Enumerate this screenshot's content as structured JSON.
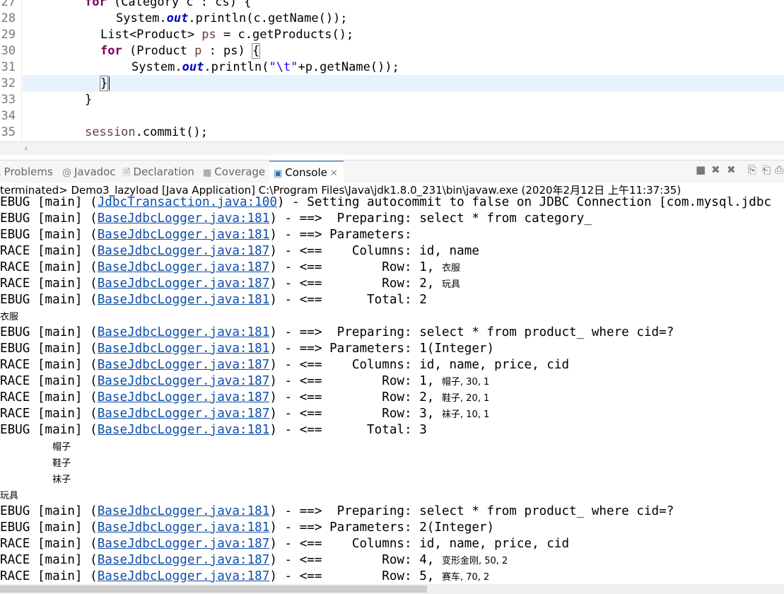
{
  "editor": {
    "line_numbers": [
      "27",
      "28",
      "29",
      "30",
      "31",
      "32",
      "33",
      "34",
      "35"
    ],
    "lines": {
      "l27": {
        "kw": "for",
        "text": " (Category c : cs) {"
      },
      "l28": {
        "a": "System.",
        "fld": "out",
        "b": ".println(c.getName());"
      },
      "l29": {
        "a": "List<Product> ",
        "var": "ps",
        "b": " = c.getProducts();"
      },
      "l30": {
        "kw": "for",
        "a": " (Product ",
        "var": "p",
        "b": " : ps) ",
        "br": "{"
      },
      "l31": {
        "a": "System.",
        "fld": "out",
        "b": ".println(",
        "str": "\"\\t\"",
        "c": "+p.getName());"
      },
      "l32": {
        "br": "}"
      },
      "l33": {
        "text": "}"
      },
      "l35": {
        "var": "session",
        "b": ".commit();"
      }
    }
  },
  "scroll": {
    "left_arrow": "‹"
  },
  "tabs": [
    {
      "label": "Problems",
      "icon": "⚠"
    },
    {
      "label": "Javadoc",
      "icon": "@"
    },
    {
      "label": "Declaration",
      "icon": "🗎"
    },
    {
      "label": "Coverage",
      "icon": "▦"
    },
    {
      "label": "Console",
      "icon": "▣",
      "close": "✕"
    }
  ],
  "toolbar_icons": [
    "■",
    "✖",
    "✖",
    "⎘",
    "⎗",
    "⎙"
  ],
  "console": {
    "status": "terminated> Demo3_lazyload [Java Application] C:\\Program Files\\Java\\jdk1.8.0_231\\bin\\javaw.exe (2020年2月12日 上午11:37:35)",
    "lines": [
      {
        "lvl": "EBUG",
        "src": "JdbcTransaction.java:100",
        "msg": " - Setting autocommit to false on JDBC Connection [com.mysql.jdbc"
      },
      {
        "lvl": "EBUG",
        "src": "BaseJdbcLogger.java:181",
        "msg": " - ==>  Preparing: select * from category_"
      },
      {
        "lvl": "EBUG",
        "src": "BaseJdbcLogger.java:181",
        "msg": " - ==> Parameters: "
      },
      {
        "lvl": "RACE",
        "src": "BaseJdbcLogger.java:187",
        "msg": " - <==    Columns: id, name"
      },
      {
        "lvl": "RACE",
        "src": "BaseJdbcLogger.java:187",
        "msg": " - <==        Row: 1, ",
        "cjk": "衣服"
      },
      {
        "lvl": "RACE",
        "src": "BaseJdbcLogger.java:187",
        "msg": " - <==        Row: 2, ",
        "cjk": "玩具"
      },
      {
        "lvl": "EBUG",
        "src": "BaseJdbcLogger.java:181",
        "msg": " - <==      Total: 2"
      },
      {
        "plain": "",
        "cjk": "衣服"
      },
      {
        "lvl": "EBUG",
        "src": "BaseJdbcLogger.java:181",
        "msg": " - ==>  Preparing: select * from product_ where cid=?"
      },
      {
        "lvl": "EBUG",
        "src": "BaseJdbcLogger.java:181",
        "msg": " - ==> Parameters: 1(Integer)"
      },
      {
        "lvl": "RACE",
        "src": "BaseJdbcLogger.java:187",
        "msg": " - <==    Columns: id, name, price, cid"
      },
      {
        "lvl": "RACE",
        "src": "BaseJdbcLogger.java:187",
        "msg": " - <==        Row: 1, ",
        "cjk": "帽子, 30, 1"
      },
      {
        "lvl": "RACE",
        "src": "BaseJdbcLogger.java:187",
        "msg": " - <==        Row: 2, ",
        "cjk": "鞋子, 20, 1"
      },
      {
        "lvl": "RACE",
        "src": "BaseJdbcLogger.java:187",
        "msg": " - <==        Row: 3, ",
        "cjk": "袜子, 10, 1"
      },
      {
        "lvl": "EBUG",
        "src": "BaseJdbcLogger.java:181",
        "msg": " - <==      Total: 3"
      },
      {
        "plain": "       ",
        "cjk": "帽子"
      },
      {
        "plain": "       ",
        "cjk": "鞋子"
      },
      {
        "plain": "       ",
        "cjk": "袜子"
      },
      {
        "plain": "",
        "cjk": "玩具"
      },
      {
        "lvl": "EBUG",
        "src": "BaseJdbcLogger.java:181",
        "msg": " - ==>  Preparing: select * from product_ where cid=?"
      },
      {
        "lvl": "EBUG",
        "src": "BaseJdbcLogger.java:181",
        "msg": " - ==> Parameters: 2(Integer)"
      },
      {
        "lvl": "RACE",
        "src": "BaseJdbcLogger.java:187",
        "msg": " - <==    Columns: id, name, price, cid"
      },
      {
        "lvl": "RACE",
        "src": "BaseJdbcLogger.java:187",
        "msg": " - <==        Row: 4, ",
        "cjk": "变形金刚, 50, 2"
      },
      {
        "lvl": "RACE",
        "src": "BaseJdbcLogger.java:187",
        "msg": " - <==        Row: 5, ",
        "cjk": "赛车, 70, 2"
      }
    ]
  }
}
